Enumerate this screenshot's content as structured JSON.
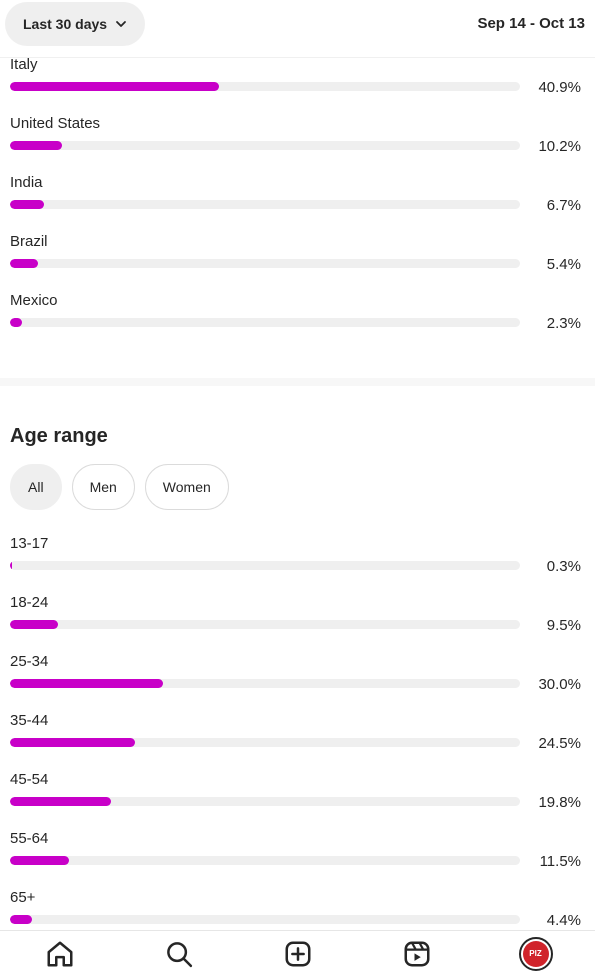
{
  "header": {
    "range_label": "Last 30 days",
    "date_range": "Sep 14 - Oct 13"
  },
  "countries": [
    {
      "label": "Italy",
      "pct_text": "40.9%",
      "value": 40.9
    },
    {
      "label": "United States",
      "pct_text": "10.2%",
      "value": 10.2
    },
    {
      "label": "India",
      "pct_text": "6.7%",
      "value": 6.7
    },
    {
      "label": "Brazil",
      "pct_text": "5.4%",
      "value": 5.4
    },
    {
      "label": "Mexico",
      "pct_text": "2.3%",
      "value": 2.3
    }
  ],
  "age_section": {
    "title": "Age range",
    "filters": [
      {
        "label": "All",
        "active": true
      },
      {
        "label": "Men",
        "active": false
      },
      {
        "label": "Women",
        "active": false
      }
    ],
    "rows": [
      {
        "label": "13-17",
        "pct_text": "0.3%",
        "value": 0.3
      },
      {
        "label": "18-24",
        "pct_text": "9.5%",
        "value": 9.5
      },
      {
        "label": "25-34",
        "pct_text": "30.0%",
        "value": 30.0
      },
      {
        "label": "35-44",
        "pct_text": "24.5%",
        "value": 24.5
      },
      {
        "label": "45-54",
        "pct_text": "19.8%",
        "value": 19.8
      },
      {
        "label": "55-64",
        "pct_text": "11.5%",
        "value": 11.5
      },
      {
        "label": "65+",
        "pct_text": "4.4%",
        "value": 4.4
      }
    ]
  },
  "nav": {
    "items": [
      "home-icon",
      "search-icon",
      "create-icon",
      "reels-icon",
      "profile-avatar"
    ],
    "avatar_text": "PIZZA"
  },
  "colors": {
    "bar_fill": "#c800c8",
    "bar_track": "#efefef"
  }
}
